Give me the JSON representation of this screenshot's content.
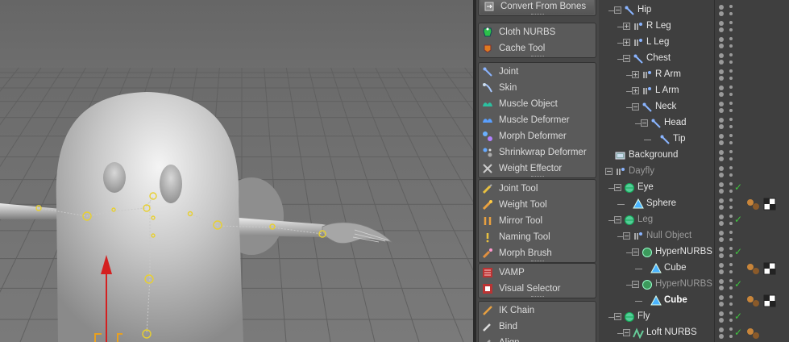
{
  "palette": {
    "groups": [
      {
        "id": "bones",
        "items": [
          {
            "icon": "convert-icon",
            "label": "Convert From Bones",
            "button": true
          }
        ]
      },
      {
        "id": "cloth",
        "items": [
          {
            "icon": "cloth-nurbs-icon",
            "label": "Cloth NURBS"
          },
          {
            "icon": "cache-tool-icon",
            "label": "Cache Tool"
          }
        ]
      },
      {
        "id": "character",
        "items": [
          {
            "icon": "joint-icon",
            "label": "Joint"
          },
          {
            "icon": "skin-icon",
            "label": "Skin"
          },
          {
            "icon": "muscle-object-icon",
            "label": "Muscle Object"
          },
          {
            "icon": "muscle-deformer-icon",
            "label": "Muscle Deformer"
          },
          {
            "icon": "morph-deformer-icon",
            "label": "Morph Deformer"
          },
          {
            "icon": "shrinkwrap-deformer-icon",
            "label": "Shrinkwrap Deformer"
          },
          {
            "icon": "weight-effector-icon",
            "label": "Weight Effector"
          }
        ]
      },
      {
        "id": "tools",
        "items": [
          {
            "icon": "joint-tool-icon",
            "label": "Joint Tool"
          },
          {
            "icon": "weight-tool-icon",
            "label": "Weight Tool"
          },
          {
            "icon": "mirror-tool-icon",
            "label": "Mirror Tool"
          },
          {
            "icon": "naming-tool-icon",
            "label": "Naming Tool"
          },
          {
            "icon": "morph-brush-icon",
            "label": "Morph Brush"
          }
        ]
      },
      {
        "id": "vamp",
        "items": [
          {
            "icon": "vamp-icon",
            "label": "VAMP"
          },
          {
            "icon": "visual-selector-icon",
            "label": "Visual Selector"
          }
        ]
      },
      {
        "id": "ik",
        "items": [
          {
            "icon": "ik-chain-icon",
            "label": "IK Chain"
          },
          {
            "icon": "bind-icon",
            "label": "Bind"
          },
          {
            "icon": "align-icon",
            "label": "Align"
          }
        ]
      }
    ]
  },
  "objects": {
    "rows": [
      {
        "name": "Hip",
        "icon": "joint-icon",
        "depth": 1,
        "expander": "minus",
        "style": "normal"
      },
      {
        "name": "R Leg",
        "icon": "null-joint-icon",
        "depth": 2,
        "expander": "plus",
        "style": "normal"
      },
      {
        "name": "L Leg",
        "icon": "null-joint-icon",
        "depth": 2,
        "expander": "plus",
        "style": "normal"
      },
      {
        "name": "Chest",
        "icon": "joint-icon",
        "depth": 2,
        "expander": "minus",
        "style": "normal"
      },
      {
        "name": "R Arm",
        "icon": "null-joint-icon",
        "depth": 3,
        "expander": "plus",
        "style": "normal"
      },
      {
        "name": "L Arm",
        "icon": "null-joint-icon",
        "depth": 3,
        "expander": "plus",
        "style": "normal"
      },
      {
        "name": "Neck",
        "icon": "joint-icon",
        "depth": 3,
        "expander": "minus",
        "style": "normal"
      },
      {
        "name": "Head",
        "icon": "joint-icon",
        "depth": 4,
        "expander": "minus",
        "style": "normal"
      },
      {
        "name": "Tip",
        "icon": "joint-icon",
        "depth": 5,
        "expander": "none",
        "style": "normal"
      },
      {
        "name": "Background",
        "icon": "background-icon",
        "depth": 0,
        "expander": "none",
        "style": "normal"
      },
      {
        "name": "Dayfly",
        "icon": "null-joint-icon",
        "depth": 0,
        "expander": "minus",
        "style": "dim"
      },
      {
        "name": "Eye",
        "icon": "sphere-group-icon",
        "depth": 1,
        "expander": "minus",
        "style": "normal",
        "check": true
      },
      {
        "name": "Sphere",
        "icon": "polygon-icon",
        "depth": 2,
        "expander": "none",
        "style": "normal",
        "tags": [
          "material-tag-icon",
          "checker-tag-icon"
        ]
      },
      {
        "name": "Leg",
        "icon": "sphere-group-icon",
        "depth": 1,
        "expander": "minus",
        "style": "dim",
        "check": true
      },
      {
        "name": "Null Object",
        "icon": "null-joint-icon",
        "depth": 2,
        "expander": "minus",
        "style": "dim"
      },
      {
        "name": "HyperNURBS",
        "icon": "hypernurbs-icon",
        "depth": 3,
        "expander": "minus",
        "style": "normal",
        "check": true
      },
      {
        "name": "Cube",
        "icon": "polygon-icon",
        "depth": 4,
        "expander": "none",
        "style": "normal",
        "tags": [
          "material-tag-icon",
          "checker-tag-icon"
        ]
      },
      {
        "name": "HyperNURBS",
        "icon": "hypernurbs-icon",
        "depth": 3,
        "expander": "minus",
        "style": "dim",
        "check": true
      },
      {
        "name": "Cube",
        "icon": "polygon-icon",
        "depth": 4,
        "expander": "none",
        "style": "sel",
        "tags": [
          "material-tag-icon",
          "checker-tag-icon"
        ]
      },
      {
        "name": "Fly",
        "icon": "sphere-group-icon",
        "depth": 1,
        "expander": "minus",
        "style": "normal",
        "check": true
      },
      {
        "name": "Loft NURBS",
        "icon": "loft-nurbs-icon",
        "depth": 2,
        "expander": "minus",
        "style": "normal",
        "check": true,
        "tags": [
          "material-tag-icon"
        ]
      }
    ]
  },
  "colors": {
    "accent_green": "#3fc43f",
    "axis_red": "#d42020",
    "axis_orange": "#e8a020"
  }
}
